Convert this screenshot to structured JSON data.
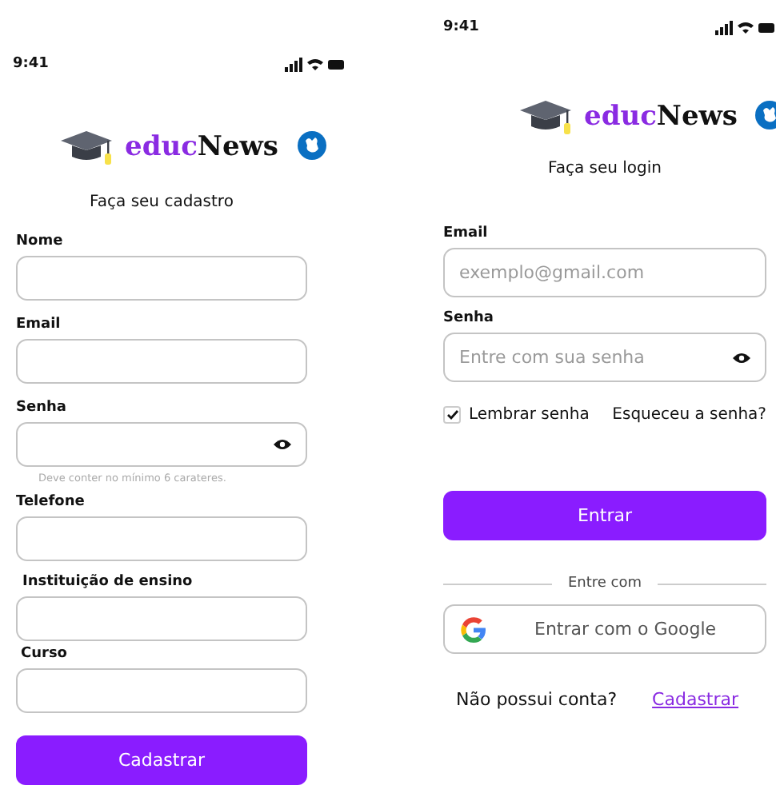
{
  "signup": {
    "status_time": "9:41",
    "logo": {
      "accent": "educ",
      "rest": "News"
    },
    "title": "Faça seu cadastro",
    "fields": [
      {
        "label": "Nome",
        "kind": "text"
      },
      {
        "label": "Email",
        "kind": "text"
      },
      {
        "label": "Senha",
        "kind": "password",
        "hint": "Deve conter no mínimo 6 carateres."
      },
      {
        "label": "Telefone",
        "kind": "text"
      },
      {
        "label": "Instituição de ensino",
        "kind": "text"
      },
      {
        "label": "Curso",
        "kind": "text"
      }
    ],
    "submit": "Cadastrar"
  },
  "login": {
    "status_time": "9:41",
    "logo": {
      "accent": "educ",
      "rest": "News"
    },
    "title": "Faça seu login",
    "fields": [
      {
        "label": "Email",
        "kind": "text",
        "placeholder": "exemplo@gmail.com"
      },
      {
        "label": "Senha",
        "kind": "password",
        "placeholder": "Entre com sua senha"
      }
    ],
    "remember": {
      "label": "Lembrar senha",
      "checked": true
    },
    "forgot": "Esqueceu a senha?",
    "submit": "Entrar",
    "divider": "Entre com",
    "google": "Entrar com o Google",
    "footer": {
      "text": "Não possui conta?",
      "link": "Cadastrar"
    }
  }
}
